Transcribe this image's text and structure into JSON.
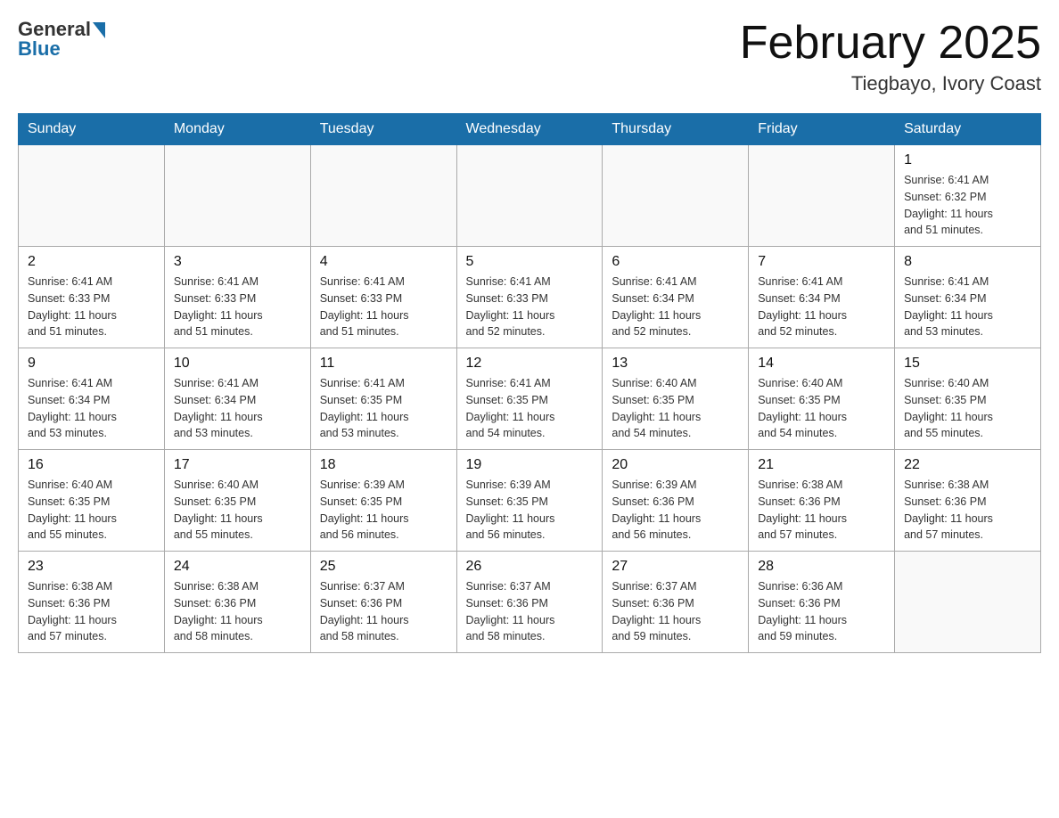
{
  "logo": {
    "general": "General",
    "blue": "Blue"
  },
  "header": {
    "month_year": "February 2025",
    "location": "Tiegbayo, Ivory Coast"
  },
  "days_of_week": [
    "Sunday",
    "Monday",
    "Tuesday",
    "Wednesday",
    "Thursday",
    "Friday",
    "Saturday"
  ],
  "weeks": [
    [
      {
        "day": "",
        "info": ""
      },
      {
        "day": "",
        "info": ""
      },
      {
        "day": "",
        "info": ""
      },
      {
        "day": "",
        "info": ""
      },
      {
        "day": "",
        "info": ""
      },
      {
        "day": "",
        "info": ""
      },
      {
        "day": "1",
        "info": "Sunrise: 6:41 AM\nSunset: 6:32 PM\nDaylight: 11 hours\nand 51 minutes."
      }
    ],
    [
      {
        "day": "2",
        "info": "Sunrise: 6:41 AM\nSunset: 6:33 PM\nDaylight: 11 hours\nand 51 minutes."
      },
      {
        "day": "3",
        "info": "Sunrise: 6:41 AM\nSunset: 6:33 PM\nDaylight: 11 hours\nand 51 minutes."
      },
      {
        "day": "4",
        "info": "Sunrise: 6:41 AM\nSunset: 6:33 PM\nDaylight: 11 hours\nand 51 minutes."
      },
      {
        "day": "5",
        "info": "Sunrise: 6:41 AM\nSunset: 6:33 PM\nDaylight: 11 hours\nand 52 minutes."
      },
      {
        "day": "6",
        "info": "Sunrise: 6:41 AM\nSunset: 6:34 PM\nDaylight: 11 hours\nand 52 minutes."
      },
      {
        "day": "7",
        "info": "Sunrise: 6:41 AM\nSunset: 6:34 PM\nDaylight: 11 hours\nand 52 minutes."
      },
      {
        "day": "8",
        "info": "Sunrise: 6:41 AM\nSunset: 6:34 PM\nDaylight: 11 hours\nand 53 minutes."
      }
    ],
    [
      {
        "day": "9",
        "info": "Sunrise: 6:41 AM\nSunset: 6:34 PM\nDaylight: 11 hours\nand 53 minutes."
      },
      {
        "day": "10",
        "info": "Sunrise: 6:41 AM\nSunset: 6:34 PM\nDaylight: 11 hours\nand 53 minutes."
      },
      {
        "day": "11",
        "info": "Sunrise: 6:41 AM\nSunset: 6:35 PM\nDaylight: 11 hours\nand 53 minutes."
      },
      {
        "day": "12",
        "info": "Sunrise: 6:41 AM\nSunset: 6:35 PM\nDaylight: 11 hours\nand 54 minutes."
      },
      {
        "day": "13",
        "info": "Sunrise: 6:40 AM\nSunset: 6:35 PM\nDaylight: 11 hours\nand 54 minutes."
      },
      {
        "day": "14",
        "info": "Sunrise: 6:40 AM\nSunset: 6:35 PM\nDaylight: 11 hours\nand 54 minutes."
      },
      {
        "day": "15",
        "info": "Sunrise: 6:40 AM\nSunset: 6:35 PM\nDaylight: 11 hours\nand 55 minutes."
      }
    ],
    [
      {
        "day": "16",
        "info": "Sunrise: 6:40 AM\nSunset: 6:35 PM\nDaylight: 11 hours\nand 55 minutes."
      },
      {
        "day": "17",
        "info": "Sunrise: 6:40 AM\nSunset: 6:35 PM\nDaylight: 11 hours\nand 55 minutes."
      },
      {
        "day": "18",
        "info": "Sunrise: 6:39 AM\nSunset: 6:35 PM\nDaylight: 11 hours\nand 56 minutes."
      },
      {
        "day": "19",
        "info": "Sunrise: 6:39 AM\nSunset: 6:35 PM\nDaylight: 11 hours\nand 56 minutes."
      },
      {
        "day": "20",
        "info": "Sunrise: 6:39 AM\nSunset: 6:36 PM\nDaylight: 11 hours\nand 56 minutes."
      },
      {
        "day": "21",
        "info": "Sunrise: 6:38 AM\nSunset: 6:36 PM\nDaylight: 11 hours\nand 57 minutes."
      },
      {
        "day": "22",
        "info": "Sunrise: 6:38 AM\nSunset: 6:36 PM\nDaylight: 11 hours\nand 57 minutes."
      }
    ],
    [
      {
        "day": "23",
        "info": "Sunrise: 6:38 AM\nSunset: 6:36 PM\nDaylight: 11 hours\nand 57 minutes."
      },
      {
        "day": "24",
        "info": "Sunrise: 6:38 AM\nSunset: 6:36 PM\nDaylight: 11 hours\nand 58 minutes."
      },
      {
        "day": "25",
        "info": "Sunrise: 6:37 AM\nSunset: 6:36 PM\nDaylight: 11 hours\nand 58 minutes."
      },
      {
        "day": "26",
        "info": "Sunrise: 6:37 AM\nSunset: 6:36 PM\nDaylight: 11 hours\nand 58 minutes."
      },
      {
        "day": "27",
        "info": "Sunrise: 6:37 AM\nSunset: 6:36 PM\nDaylight: 11 hours\nand 59 minutes."
      },
      {
        "day": "28",
        "info": "Sunrise: 6:36 AM\nSunset: 6:36 PM\nDaylight: 11 hours\nand 59 minutes."
      },
      {
        "day": "",
        "info": ""
      }
    ]
  ]
}
